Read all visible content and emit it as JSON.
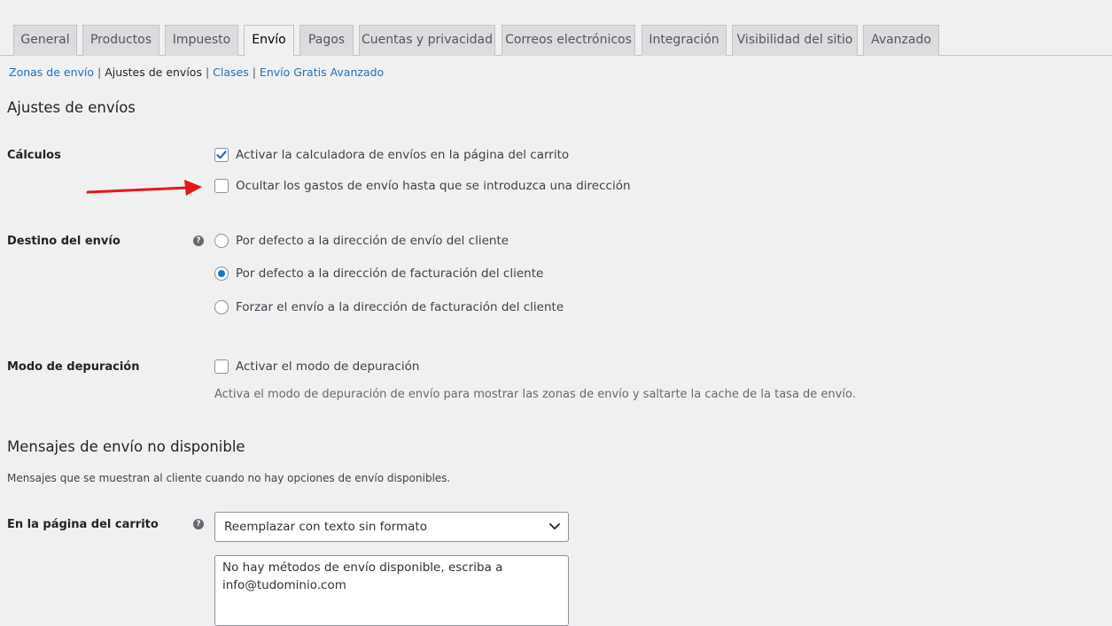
{
  "tabs": [
    {
      "label": "General",
      "active": false
    },
    {
      "label": "Productos",
      "active": false
    },
    {
      "label": "Impuesto",
      "active": false
    },
    {
      "label": "Envío",
      "active": true
    },
    {
      "label": "Pagos",
      "active": false
    },
    {
      "label": "Cuentas y privacidad",
      "active": false
    },
    {
      "label": "Correos electrónicos",
      "active": false
    },
    {
      "label": "Integración",
      "active": false
    },
    {
      "label": "Visibilidad del sitio",
      "active": false
    },
    {
      "label": "Avanzado",
      "active": false
    }
  ],
  "sublinks": [
    {
      "label": "Zonas de envío",
      "current": false
    },
    {
      "label": "Ajustes de envíos",
      "current": true
    },
    {
      "label": "Clases",
      "current": false
    },
    {
      "label": "Envío Gratis Avanzado",
      "current": false
    }
  ],
  "section1": {
    "title": "Ajustes de envíos",
    "calculos": {
      "label": "Cálculos",
      "opt1": {
        "label": "Activar la calculadora de envíos en la página del carrito",
        "checked": true
      },
      "opt2": {
        "label": "Ocultar los gastos de envío hasta que se introduzca una dirección",
        "checked": false
      }
    },
    "destino": {
      "label": "Destino del envío",
      "help": "?",
      "opt1": {
        "label": "Por defecto a la dirección de envío del cliente",
        "selected": false
      },
      "opt2": {
        "label": "Por defecto a la dirección de facturación del cliente",
        "selected": true
      },
      "opt3": {
        "label": "Forzar el envío a la dirección de facturación del cliente",
        "selected": false
      }
    },
    "depuracion": {
      "label": "Modo de depuración",
      "opt1": {
        "label": "Activar el modo de depuración",
        "checked": false
      },
      "description": "Activa el modo de depuración de envío para mostrar las zonas de envío y saltarte la cache de la tasa de envío."
    }
  },
  "section2": {
    "title": "Mensajes de envío no disponible",
    "description": "Mensajes que se muestran al cliente cuando no hay opciones de envío disponibles.",
    "carrito": {
      "label": "En la página del carrito",
      "help": "?",
      "select_value": "Reemplazar con texto sin formato",
      "textarea_line1": "No hay métodos de envío disponible, escriba a",
      "textarea_line2": "info@tudominio.com"
    }
  },
  "colors": {
    "accent": "#2271b1",
    "annotation_arrow": "#e8151b"
  }
}
